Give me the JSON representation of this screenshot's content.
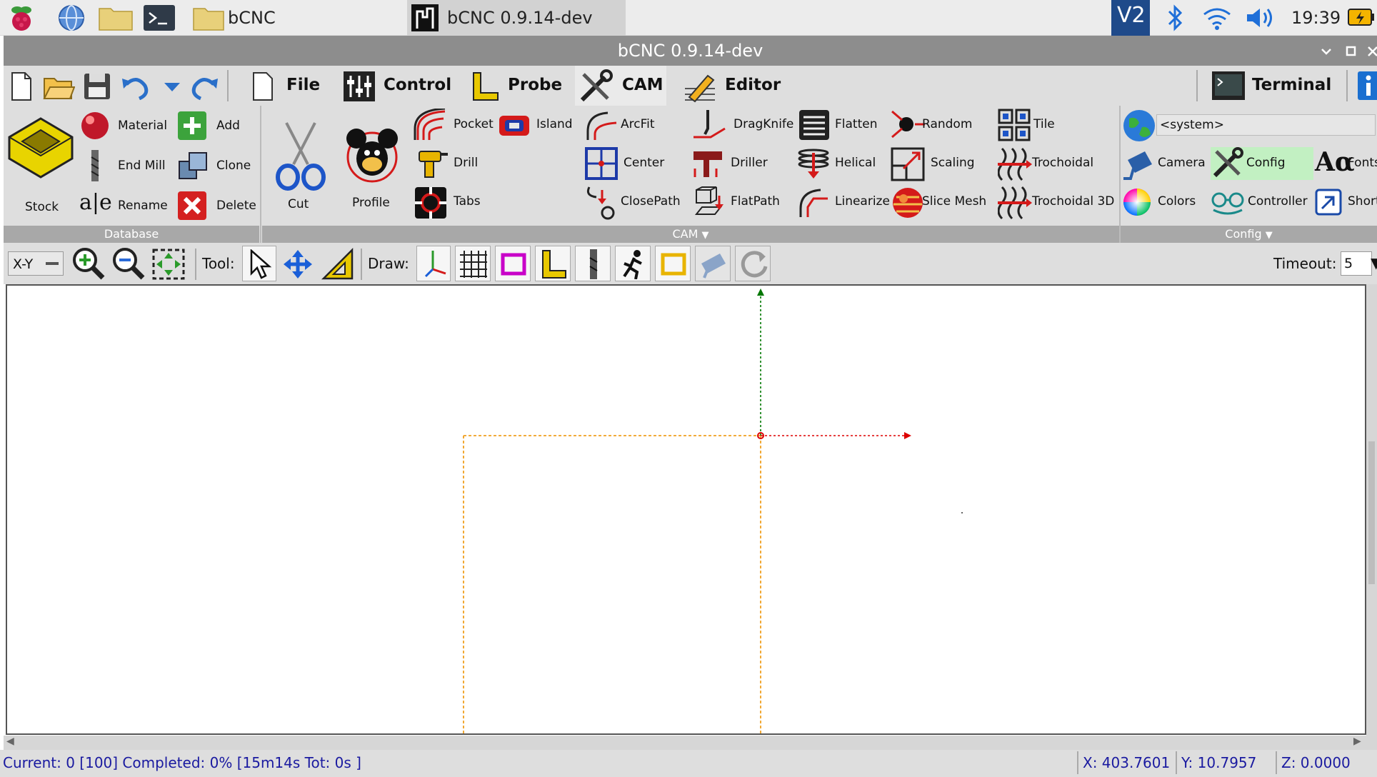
{
  "taskbar": {
    "apps": [
      "bCNC",
      "bCNC 0.9.14-dev"
    ],
    "clock": "19:39",
    "vnc_label": "V2"
  },
  "window": {
    "title": "bCNC 0.9.14-dev",
    "controls": [
      "minimize",
      "maximize",
      "close"
    ]
  },
  "tabs": [
    {
      "label": "File"
    },
    {
      "label": "Control"
    },
    {
      "label": "Probe"
    },
    {
      "label": "CAM",
      "active": true
    },
    {
      "label": "Editor"
    }
  ],
  "terminal_label": "Terminal",
  "database": {
    "group_label": "Database",
    "stock_label": "Stock",
    "items": [
      "Material",
      "End Mill",
      "Rename",
      "Add",
      "Clone",
      "Delete"
    ]
  },
  "cam": {
    "group_label": "CAM",
    "cut_label": "Cut",
    "profile_label": "Profile",
    "items": [
      "Pocket",
      "Drill",
      "Tabs",
      "Island",
      "ArcFit",
      "Center",
      "ClosePath",
      "DragKnife",
      "Driller",
      "FlatPath",
      "Flatten",
      "Helical",
      "Linearize",
      "Random",
      "Scaling",
      "Slice Mesh",
      "Tile",
      "Trochoidal",
      "Trochoidal 3D"
    ]
  },
  "config": {
    "group_label": "Config",
    "system_value": "<system>",
    "items": [
      "Camera",
      "Config",
      "Fonts",
      "Colors",
      "Controller",
      "Shortc"
    ]
  },
  "view_toolbar": {
    "view_select": "X-Y",
    "tool_label": "Tool:",
    "draw_label": "Draw:",
    "timeout_label": "Timeout:",
    "timeout_value": "5"
  },
  "status": {
    "progress": "Current: 0 [100]  Completed: 0% [15m14s Tot: 0s ]",
    "x": "X: 403.7601",
    "y": "Y: 10.7957",
    "z": "Z: 0.0000"
  },
  "colors": {
    "titlebar": "#8d8d8d",
    "ribbon_bg": "#dedede",
    "status_text": "#1a1aa0",
    "axis_x": "#dd0000",
    "axis_y": "#007700",
    "stock_outline": "#f0a020"
  }
}
